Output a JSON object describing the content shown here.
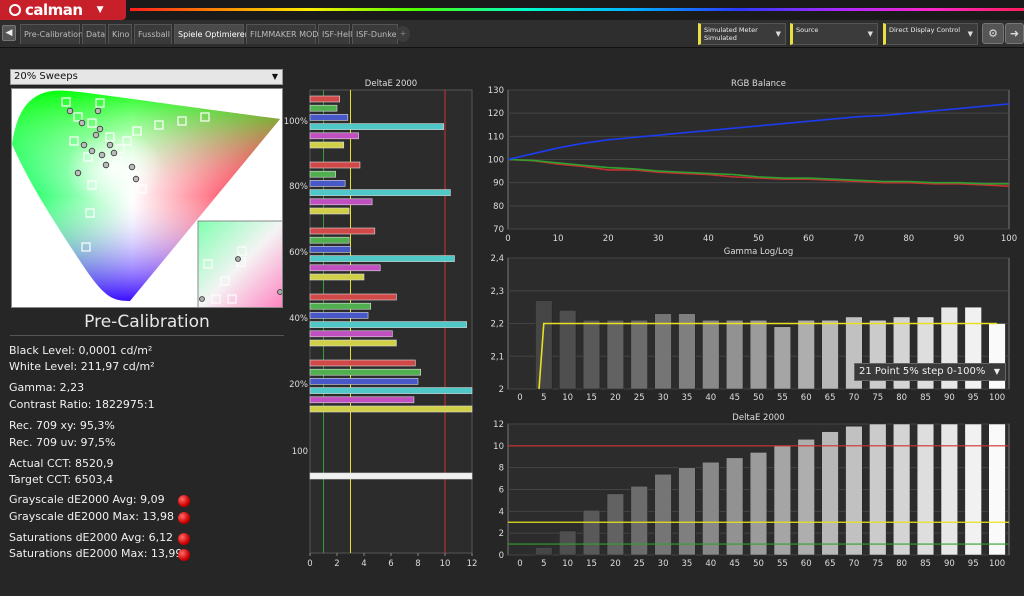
{
  "app": {
    "logo_text": "calman"
  },
  "tabs": [
    "Pre-Calibration",
    "Data",
    "Kino",
    "Fussball",
    "Spiele Optimierer",
    "FILMMAKER MODE",
    "ISF-Hell",
    "ISF-Dunkel"
  ],
  "active_tab": "Spiele Optimierer",
  "toolbar": {
    "meter_line1": "Simulated Meter",
    "meter_line2": "Simulated",
    "source": "Source",
    "display_control": "Direct Display Control",
    "icon_names": [
      "gear-icon",
      "arrow-right-icon"
    ]
  },
  "left": {
    "sweep_select": "20% Sweeps",
    "title": "Pre-Calibration",
    "stats": {
      "black_level": "Black Level: 0,0001 cd/m²",
      "white_level": "White Level: 211,97 cd/m²",
      "gamma": "Gamma: 2,23",
      "contrast": "Contrast Ratio: 1822975:1",
      "rec709_xy": "Rec. 709 xy: 95,3%",
      "rec709_uv": "Rec. 709 uv: 97,5%",
      "actual_cct": "Actual CCT: 8520,9",
      "target_cct": "Target CCT: 6503,4",
      "gs_avg": "Grayscale dE2000 Avg: 9,09",
      "gs_max": "Grayscale dE2000 Max: 13,98",
      "sat_avg": "Saturations dE2000 Avg: 6,12",
      "sat_max": "Saturations dE2000 Max: 13,99"
    },
    "status_colors": {
      "fail": "#d00000"
    }
  },
  "colors": {
    "red_limit": "#d03030",
    "yellow_limit": "#e8e020",
    "green_limit": "#30a030",
    "blue_line": "#1c3cf0"
  },
  "chart_data": [
    {
      "type": "bar",
      "title": "DeltaE 2000",
      "orientation": "horizontal",
      "xlim": [
        0,
        12
      ],
      "x_ticks": [
        0,
        2,
        4,
        6,
        8,
        10,
        12
      ],
      "y_labels": [
        "100%",
        "80%",
        "60%",
        "40%",
        "20%",
        "100"
      ],
      "thresholds": [
        1,
        3,
        10
      ],
      "groups": [
        {
          "level": "100%",
          "bars": [
            {
              "color": "#d04848",
              "value": 2.2
            },
            {
              "color": "#50b050",
              "value": 2.0
            },
            {
              "color": "#4858c8",
              "value": 2.8
            },
            {
              "color": "#50c8c8",
              "value": 9.9
            },
            {
              "color": "#c050c0",
              "value": 3.6
            },
            {
              "color": "#d0d048",
              "value": 2.5
            }
          ]
        },
        {
          "level": "80%",
          "bars": [
            {
              "color": "#d04848",
              "value": 3.7
            },
            {
              "color": "#50b050",
              "value": 1.9
            },
            {
              "color": "#4858c8",
              "value": 2.6
            },
            {
              "color": "#50c8c8",
              "value": 10.4
            },
            {
              "color": "#c050c0",
              "value": 4.6
            },
            {
              "color": "#d0d048",
              "value": 2.9
            }
          ]
        },
        {
          "level": "60%",
          "bars": [
            {
              "color": "#d04848",
              "value": 4.8
            },
            {
              "color": "#50b050",
              "value": 2.9
            },
            {
              "color": "#4858c8",
              "value": 3.0
            },
            {
              "color": "#50c8c8",
              "value": 10.7
            },
            {
              "color": "#c050c0",
              "value": 5.2
            },
            {
              "color": "#d0d048",
              "value": 4.0
            }
          ]
        },
        {
          "level": "40%",
          "bars": [
            {
              "color": "#d04848",
              "value": 6.4
            },
            {
              "color": "#50b050",
              "value": 4.5
            },
            {
              "color": "#4858c8",
              "value": 4.3
            },
            {
              "color": "#50c8c8",
              "value": 11.6
            },
            {
              "color": "#c050c0",
              "value": 6.1
            },
            {
              "color": "#d0d048",
              "value": 6.4
            }
          ]
        },
        {
          "level": "20%",
          "bars": [
            {
              "color": "#d04848",
              "value": 7.8
            },
            {
              "color": "#50b050",
              "value": 8.2
            },
            {
              "color": "#4858c8",
              "value": 8.0
            },
            {
              "color": "#50c8c8",
              "value": 12.0
            },
            {
              "color": "#c050c0",
              "value": 7.7
            },
            {
              "color": "#d0d048",
              "value": 12.0
            }
          ]
        },
        {
          "level": "100",
          "bars": [
            {
              "color": "#f0f0f0",
              "value": 12.0
            }
          ]
        }
      ]
    },
    {
      "type": "line",
      "title": "RGB Balance",
      "x": [
        0,
        5,
        10,
        15,
        20,
        25,
        30,
        35,
        40,
        45,
        50,
        55,
        60,
        65,
        70,
        75,
        80,
        85,
        90,
        95,
        100
      ],
      "ylim": [
        70,
        130
      ],
      "y_ticks": [
        70,
        80,
        90,
        100,
        110,
        120,
        130
      ],
      "series": [
        {
          "color": "#c83030",
          "values": [
            100,
            99.5,
            98,
            97,
            95.5,
            95.5,
            94.5,
            94,
            93.5,
            92.5,
            92,
            91.5,
            91.5,
            91,
            90.5,
            90,
            90,
            89.5,
            89.5,
            89,
            88.5
          ]
        },
        {
          "color": "#30a030",
          "values": [
            100,
            99.6,
            98.5,
            97.5,
            96.5,
            96,
            95,
            94.5,
            94,
            93.5,
            92.5,
            92,
            92,
            91.5,
            91,
            90.5,
            90.5,
            90,
            90,
            89.5,
            89.5
          ]
        },
        {
          "color": "#1c3cf0",
          "values": [
            100,
            102.5,
            105,
            107,
            108.5,
            109.5,
            110.5,
            111.5,
            112.5,
            113.5,
            114.5,
            115.5,
            116.5,
            117.5,
            118.5,
            119,
            120,
            121,
            122,
            123,
            124
          ]
        }
      ]
    },
    {
      "type": "bar",
      "title": "Gamma Log/Log",
      "categories": [
        "0",
        "5",
        "10",
        "15",
        "20",
        "25",
        "30",
        "35",
        "40",
        "45",
        "50",
        "55",
        "60",
        "65",
        "70",
        "75",
        "80",
        "85",
        "90",
        "95",
        "100"
      ],
      "values": [
        null,
        2.27,
        2.24,
        2.21,
        2.21,
        2.21,
        2.23,
        2.23,
        2.21,
        2.21,
        2.21,
        2.19,
        2.21,
        2.21,
        2.22,
        2.21,
        2.22,
        2.22,
        2.25,
        2.25,
        2.2
      ],
      "target": [
        null,
        2.2,
        2.2,
        2.2,
        2.2,
        2.2,
        2.2,
        2.2,
        2.2,
        2.2,
        2.2,
        2.2,
        2.2,
        2.2,
        2.2,
        2.2,
        2.2,
        2.2,
        2.2,
        2.2,
        2.2
      ],
      "ylim": [
        2,
        2.4
      ],
      "y_labels": [
        "2,4",
        "2,3",
        "2,2",
        "2,1",
        "2"
      ],
      "dropdown": "21 Point 5% step 0-100%"
    },
    {
      "type": "bar",
      "title": "DeltaE 2000",
      "categories": [
        "0",
        "5",
        "10",
        "15",
        "20",
        "25",
        "30",
        "35",
        "40",
        "45",
        "50",
        "55",
        "60",
        "65",
        "70",
        "75",
        "80",
        "85",
        "90",
        "95",
        "100"
      ],
      "values": [
        null,
        0.7,
        2.2,
        4.1,
        5.6,
        6.3,
        7.4,
        8.0,
        8.5,
        8.9,
        9.4,
        10.0,
        10.6,
        11.3,
        11.8,
        12.0,
        12.0,
        12.0,
        12.0,
        12.0,
        12.0
      ],
      "ylim": [
        0,
        12
      ],
      "y_ticks": [
        0,
        2,
        4,
        6,
        8,
        10,
        12
      ],
      "thresholds": [
        1,
        3,
        10
      ]
    }
  ]
}
